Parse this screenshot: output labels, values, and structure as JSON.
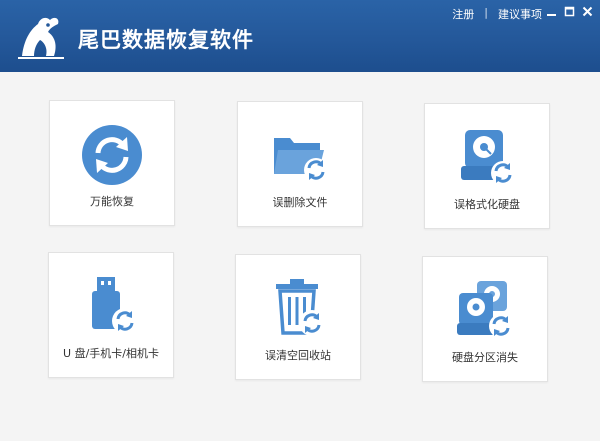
{
  "app": {
    "title": "尾巴数据恢复软件",
    "brand_color": "#24589a",
    "icon_color": "#4a8cd0"
  },
  "header": {
    "links": [
      {
        "label": "注册"
      },
      {
        "label": "建议事项"
      }
    ],
    "separator": "|",
    "window_controls": [
      "minimize-icon",
      "maximize-icon",
      "close-icon"
    ]
  },
  "options": [
    {
      "label": "万能恢复",
      "icon": "refresh-circle-icon"
    },
    {
      "label": "误删除文件",
      "icon": "folder-recover-icon"
    },
    {
      "label": "误格式化硬盘",
      "icon": "hard-disk-recover-icon"
    },
    {
      "label": "U 盘/手机卡/相机卡",
      "icon": "usb-drive-recover-icon"
    },
    {
      "label": "误清空回收站",
      "icon": "recycle-bin-recover-icon"
    },
    {
      "label": "硬盘分区消失",
      "icon": "partition-recover-icon"
    }
  ]
}
